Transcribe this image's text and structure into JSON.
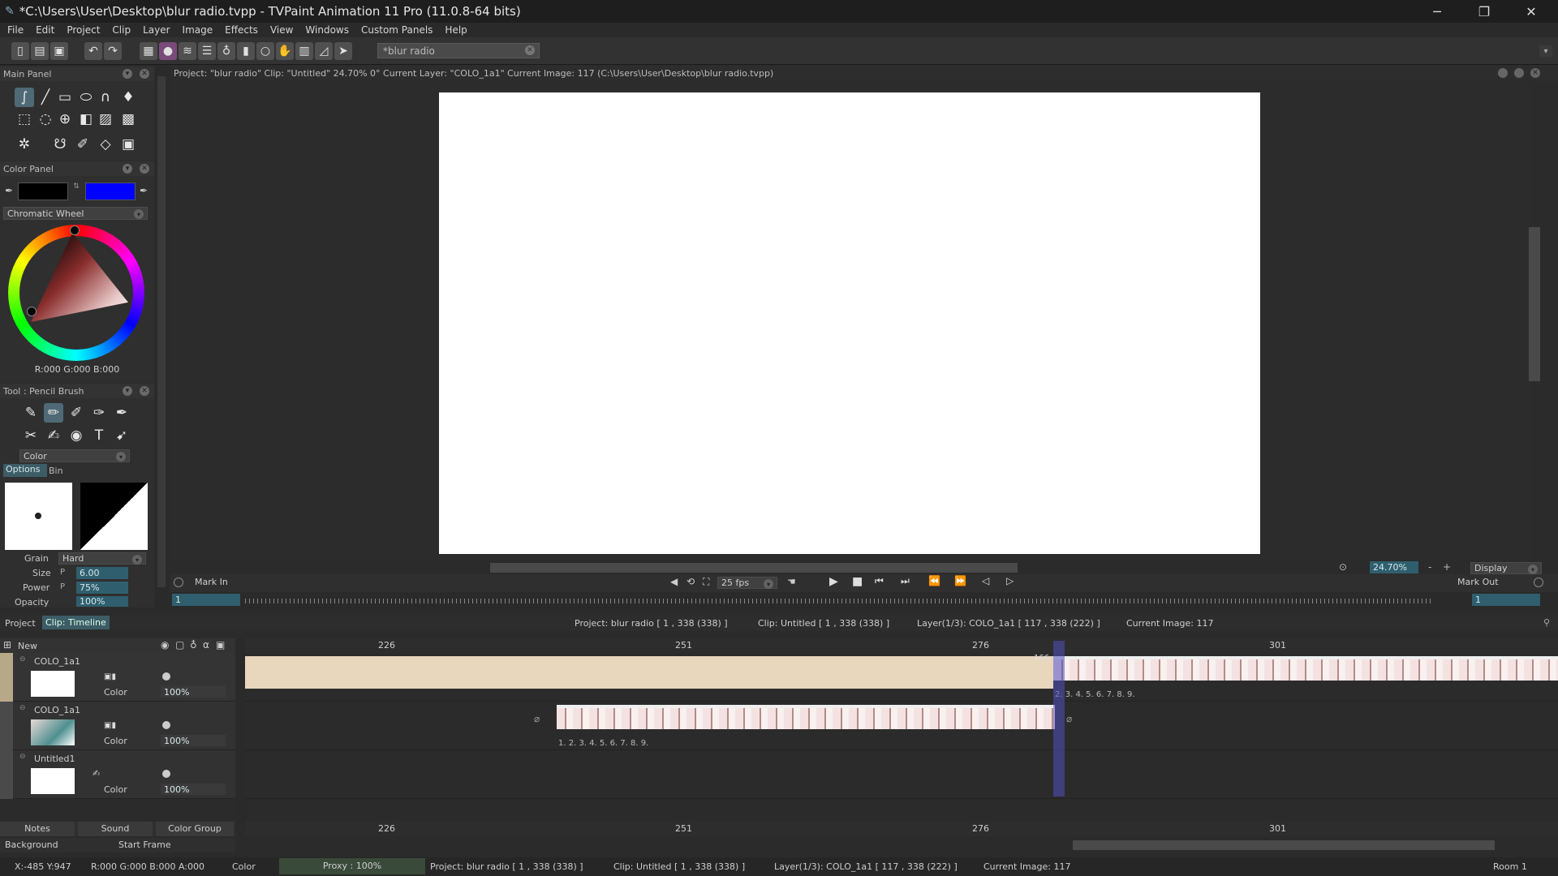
{
  "window": {
    "title": "*C:\\Users\\User\\Desktop\\blur radio.tvpp - TVPaint Animation 11 Pro (11.0.8-64 bits)"
  },
  "menu": [
    "File",
    "Edit",
    "Project",
    "Clip",
    "Layer",
    "Image",
    "Effects",
    "View",
    "Windows",
    "Custom Panels",
    "Help"
  ],
  "toolbar": {
    "search_value": "*blur radio"
  },
  "main_panel": {
    "title": "Main Panel"
  },
  "color_panel": {
    "title": "Color Panel",
    "primary_color": "#000000",
    "secondary_color": "#0000ff",
    "mode": "Chromatic Wheel",
    "readout": "R:000 G:000 B:000"
  },
  "tool_panel": {
    "title": "Tool : Pencil Brush",
    "mode": "Color",
    "tabs": [
      "Options",
      "Bin"
    ],
    "grain_label": "Grain",
    "grain_value": "Hard",
    "size_label": "Size",
    "size_value": "6.00",
    "power_label": "Power",
    "power_value": "75%",
    "opacity_label": "Opacity",
    "opacity_value": "100%",
    "pressure_flag": "P"
  },
  "view": {
    "header": "Project: \"blur radio\"  Clip: \"Untitled\"   24.70%   0°  Current Layer: \"COLO_1a1\"   Current Image: 117 (C:\\Users\\User\\Desktop\\blur radio.tvpp)",
    "zoom": "24.70%",
    "display": "Display"
  },
  "player": {
    "mark_in": "Mark In",
    "mark_out": "Mark Out",
    "fps": "25 fps",
    "start": "1",
    "end": "1"
  },
  "timeline": {
    "tabs": [
      "Project",
      "Clip: Timeline"
    ],
    "info_project": "Project: blur radio [ 1 , 338  (338) ]",
    "info_clip": "Clip: Untitled [ 1 , 338  (338) ]",
    "info_layer": "Layer(1/3): COLO_1a1 [ 117 , 338  (222) ]",
    "info_image": "Current Image: 117",
    "new_label": "New",
    "ruler": [
      "226",
      "251",
      "276",
      "301"
    ],
    "current_frame_marker": "166",
    "layers": [
      {
        "name": "COLO_1a1",
        "mode": "Color",
        "opacity": "100%"
      },
      {
        "name": "COLO_1a1",
        "mode": "Color",
        "opacity": "100%"
      },
      {
        "name": "Untitled1",
        "mode": "Color",
        "opacity": "100%"
      }
    ],
    "frame_numbers": "1. 2. 3. 4. 5. 6. 7. 8. 9.",
    "frame_numbers_top": "2. 3. 4. 5. 6. 7. 8. 9.",
    "bottom_tabs": [
      "Notes",
      "Sound",
      "Color Group"
    ],
    "background_label": "Background",
    "start_frame_label": "Start Frame"
  },
  "status": {
    "coords": "X:-485  Y:947",
    "rgba": "R:000 G:000 B:000 A:000",
    "color": "Color",
    "proxy": "Proxy : 100%",
    "project": "Project: blur radio [ 1 , 338  (338) ]",
    "clip": "Clip: Untitled [ 1 , 338  (338) ]",
    "layer": "Layer(1/3): COLO_1a1 [ 117 , 338  (222) ]",
    "image": "Current Image: 117",
    "room": "Room 1"
  }
}
